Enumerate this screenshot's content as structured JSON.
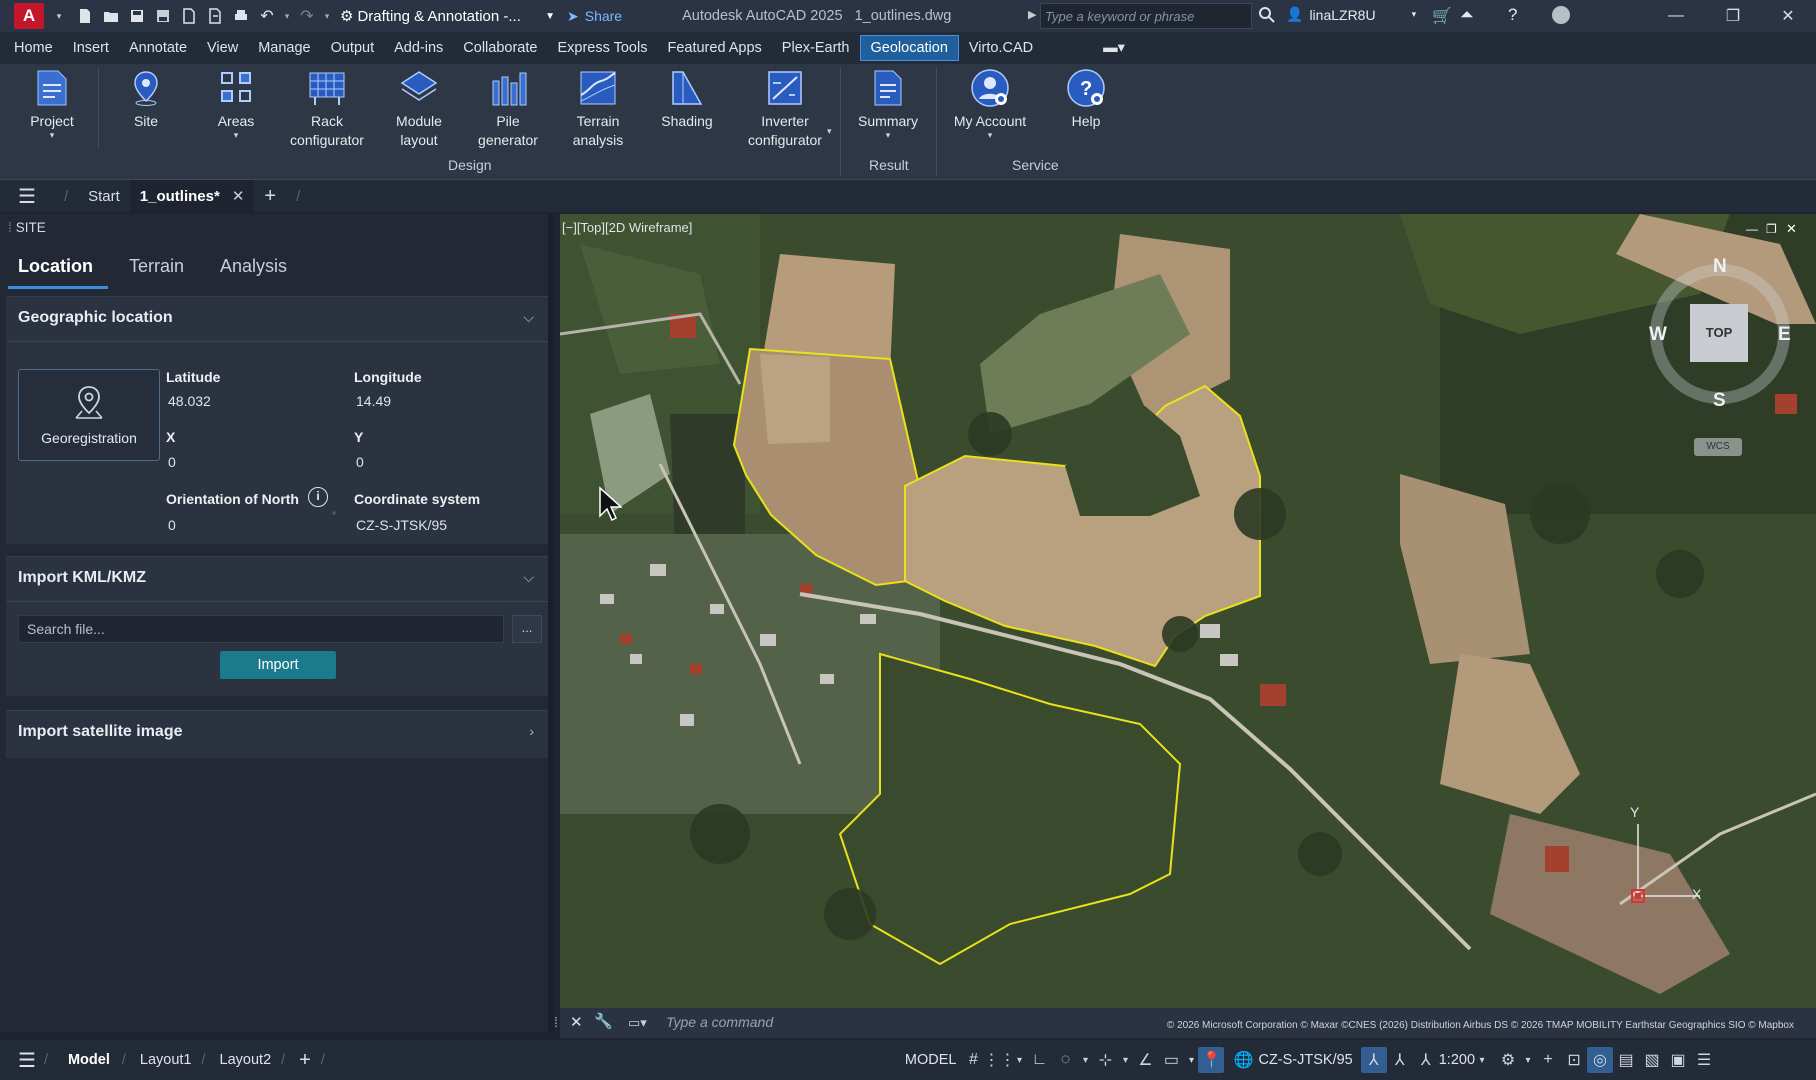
{
  "app": {
    "logo": "A",
    "workspace": "Drafting & Annotation -...",
    "share": "Share",
    "title": "Autodesk AutoCAD 2025",
    "filename": "1_outlines.dwg",
    "search_placeholder": "Type a keyword or phrase",
    "user": "linaLZR8U"
  },
  "menu": [
    "Home",
    "Insert",
    "Annotate",
    "View",
    "Manage",
    "Output",
    "Add-ins",
    "Collaborate",
    "Express Tools",
    "Featured Apps",
    "Plex-Earth",
    "Geolocation",
    "Virto.CAD"
  ],
  "menu_active": "Geolocation",
  "ribbon": {
    "buttons": [
      {
        "l1": "Project",
        "l2": "",
        "dd": true
      },
      {
        "l1": "Site",
        "l2": "",
        "dd": false
      },
      {
        "l1": "Areas",
        "l2": "",
        "dd": true
      },
      {
        "l1": "Rack",
        "l2": "configurator",
        "dd": false
      },
      {
        "l1": "Module",
        "l2": "layout",
        "dd": true
      },
      {
        "l1": "Pile",
        "l2": "generator",
        "dd": false
      },
      {
        "l1": "Terrain",
        "l2": "analysis",
        "dd": false
      },
      {
        "l1": "Shading",
        "l2": "",
        "dd": false
      },
      {
        "l1": "Inverter",
        "l2": "configurator",
        "dd": true
      },
      {
        "l1": "Summary",
        "l2": "",
        "dd": true
      },
      {
        "l1": "My Account",
        "l2": "",
        "dd": true
      },
      {
        "l1": "Help",
        "l2": "",
        "dd": false
      }
    ],
    "panels": [
      "Design",
      "Result",
      "Service"
    ]
  },
  "filetabs": {
    "start": "Start",
    "active": "1_outlines*"
  },
  "site_panel": {
    "title": "SITE",
    "tabs": [
      "Location",
      "Terrain",
      "Analysis"
    ],
    "geo": {
      "header": "Geographic location",
      "georeg": "Georegistration",
      "lat_label": "Latitude",
      "lat": "48.032",
      "lon_label": "Longitude",
      "lon": "14.49",
      "x_label": "X",
      "x": "0",
      "y_label": "Y",
      "y": "0",
      "north_label": "Orientation of North",
      "north": "0",
      "cs_label": "Coordinate system",
      "cs": "CZ-S-JTSK/95"
    },
    "kml": {
      "header": "Import KML/KMZ",
      "placeholder": "Search file...",
      "browse": "...",
      "import": "Import"
    },
    "sat": {
      "header": "Import satellite image"
    }
  },
  "viewport": {
    "label": "[−][Top][2D Wireframe]",
    "compass": {
      "n": "N",
      "s": "S",
      "e": "E",
      "w": "W",
      "top": "TOP",
      "wcs": "WCS"
    },
    "ucs": {
      "x": "X",
      "y": "Y"
    },
    "copyright": "© 2026 Microsoft Corporation © Maxar ©CNES (2026) Distribution Airbus DS © 2026 TMAP MOBILITY Earthstar Geographics  SIO © Mapbox"
  },
  "command": {
    "placeholder": "Type a command"
  },
  "status": {
    "model_tab": "Model",
    "layout1": "Layout1",
    "layout2": "Layout2",
    "model_space": "MODEL",
    "cs": "CZ-S-JTSK/95",
    "scale": "1:200"
  },
  "colors": {
    "accent": "#1f5f9c",
    "outline": "#e8e21a",
    "import_btn": "#1b7a8c"
  }
}
